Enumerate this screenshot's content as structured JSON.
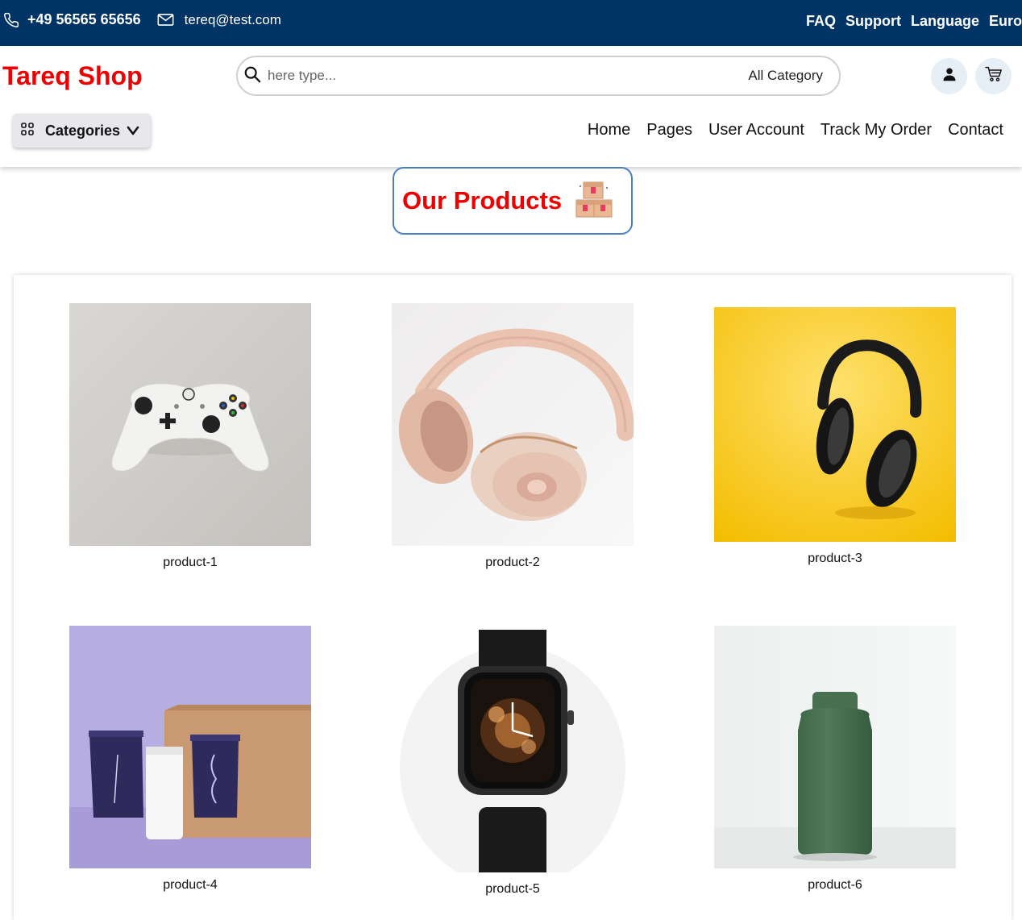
{
  "topbar": {
    "phone": "+49 56565 65656",
    "email": "tereq@test.com",
    "links": [
      "FAQ",
      "Support",
      "Language",
      "Euro"
    ]
  },
  "header": {
    "logo": "Tareq Shop",
    "search": {
      "placeholder": "here type...",
      "category": "All Category"
    },
    "categories_button": "Categories",
    "nav": [
      "Home",
      "Pages",
      "User Account",
      "Track My Order",
      "Contact"
    ]
  },
  "section": {
    "title": "Our Products"
  },
  "products": [
    {
      "label": "product-1",
      "image": "game-controller"
    },
    {
      "label": "product-2",
      "image": "pink-headphones"
    },
    {
      "label": "product-3",
      "image": "black-headphones-yellow"
    },
    {
      "label": "product-4",
      "image": "skincare-tubes"
    },
    {
      "label": "product-5",
      "image": "smartwatch"
    },
    {
      "label": "product-6",
      "image": "green-bottle"
    }
  ],
  "colors": {
    "topbar": "#003366",
    "brand_red": "#ee0000",
    "title_border": "#4a7fc1"
  },
  "icons": [
    "phone-icon",
    "mail-icon",
    "search-icon",
    "user-icon",
    "cart-icon",
    "grid-icon",
    "chevron-down-icon",
    "boxes-icon"
  ]
}
